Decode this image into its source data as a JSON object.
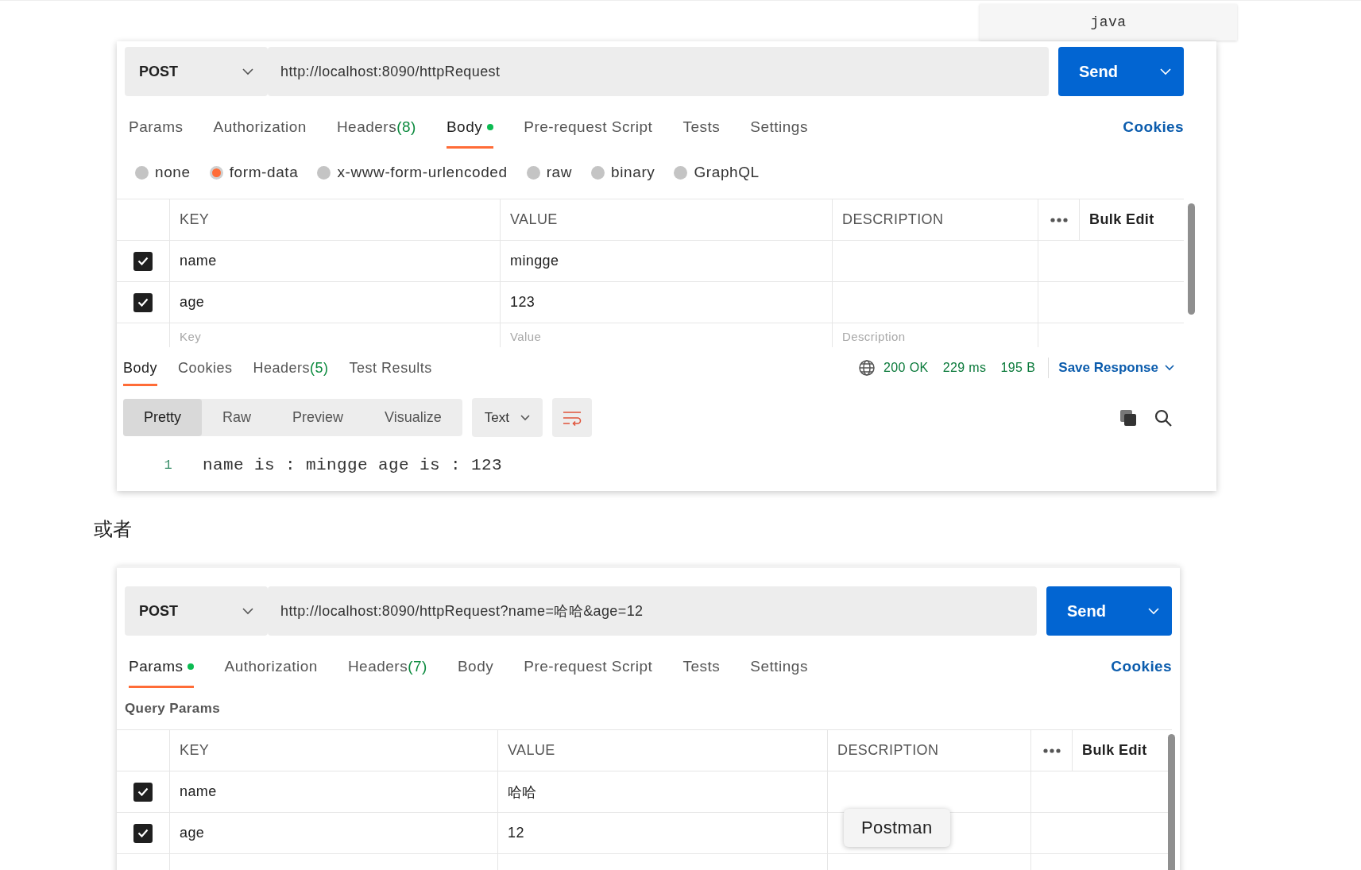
{
  "code_block": {
    "language": "java"
  },
  "blocks": [
    {
      "kind": "postman",
      "method": "POST",
      "url": "http://localhost:8090/httpRequest",
      "send": "Send",
      "tabs": [
        {
          "label": "Params",
          "dot": false,
          "selected": false
        },
        {
          "label": "Authorization",
          "dot": false,
          "selected": false
        },
        {
          "label": "Headers",
          "count": "(8)",
          "dot": false,
          "selected": false
        },
        {
          "label": "Body",
          "dot": true,
          "selected": true
        },
        {
          "label": "Pre-request Script",
          "dot": false,
          "selected": false
        },
        {
          "label": "Tests",
          "dot": false,
          "selected": false
        },
        {
          "label": "Settings",
          "dot": false,
          "selected": false
        }
      ],
      "cookies": "Cookies",
      "body_types": [
        {
          "label": "none",
          "selected": false
        },
        {
          "label": "form-data",
          "selected": true
        },
        {
          "label": "x-www-form-urlencoded",
          "selected": false
        },
        {
          "label": "raw",
          "selected": false
        },
        {
          "label": "binary",
          "selected": false
        },
        {
          "label": "GraphQL",
          "selected": false
        }
      ],
      "table": {
        "columns": [
          "KEY",
          "VALUE",
          "DESCRIPTION"
        ],
        "bulk_edit": "Bulk Edit",
        "rows": [
          {
            "key": "name",
            "value": "mingge",
            "checked": true
          },
          {
            "key": "age",
            "value": "123",
            "checked": true
          }
        ],
        "new_row": {
          "key": {
            "placeholder": "Key"
          },
          "value": {
            "placeholder": "Value"
          },
          "description": {
            "placeholder": "Description"
          }
        }
      },
      "response": {
        "tabs": [
          {
            "label": "Body",
            "selected": true
          },
          {
            "label": "Cookies",
            "selected": false
          },
          {
            "label": "Headers",
            "count": "(5)",
            "selected": false
          },
          {
            "label": "Test Results",
            "selected": false
          }
        ],
        "status": "200 OK",
        "time": "229 ms",
        "size": "195 B",
        "save": "Save Response",
        "views": [
          {
            "label": "Pretty",
            "selected": true
          },
          {
            "label": "Raw",
            "selected": false
          },
          {
            "label": "Preview",
            "selected": false
          },
          {
            "label": "Visualize",
            "selected": false
          }
        ],
        "format": "Text",
        "lines": [
          {
            "number": "1",
            "text": "name is : mingge age is : 123"
          }
        ]
      }
    },
    {
      "kind": "text",
      "text": "或者"
    },
    {
      "kind": "postman",
      "method": "POST",
      "url": "http://localhost:8090/httpRequest?name=哈哈&age=12",
      "send": "Send",
      "tabs": [
        {
          "label": "Params",
          "dot": true,
          "selected": true
        },
        {
          "label": "Authorization",
          "dot": false,
          "selected": false
        },
        {
          "label": "Headers",
          "count": "(7)",
          "dot": false,
          "selected": false
        },
        {
          "label": "Body",
          "dot": false,
          "selected": false
        },
        {
          "label": "Pre-request Script",
          "dot": false,
          "selected": false
        },
        {
          "label": "Tests",
          "dot": false,
          "selected": false
        },
        {
          "label": "Settings",
          "dot": false,
          "selected": false
        }
      ],
      "cookies": "Cookies",
      "section_title": "Query Params",
      "table": {
        "columns": [
          "KEY",
          "VALUE",
          "DESCRIPTION"
        ],
        "bulk_edit": "Bulk Edit",
        "rows": [
          {
            "key": "name",
            "value": "哈哈",
            "checked": true
          },
          {
            "key": "age",
            "value": "12",
            "checked": true
          }
        ]
      },
      "tooltip": "Postman"
    }
  ]
}
